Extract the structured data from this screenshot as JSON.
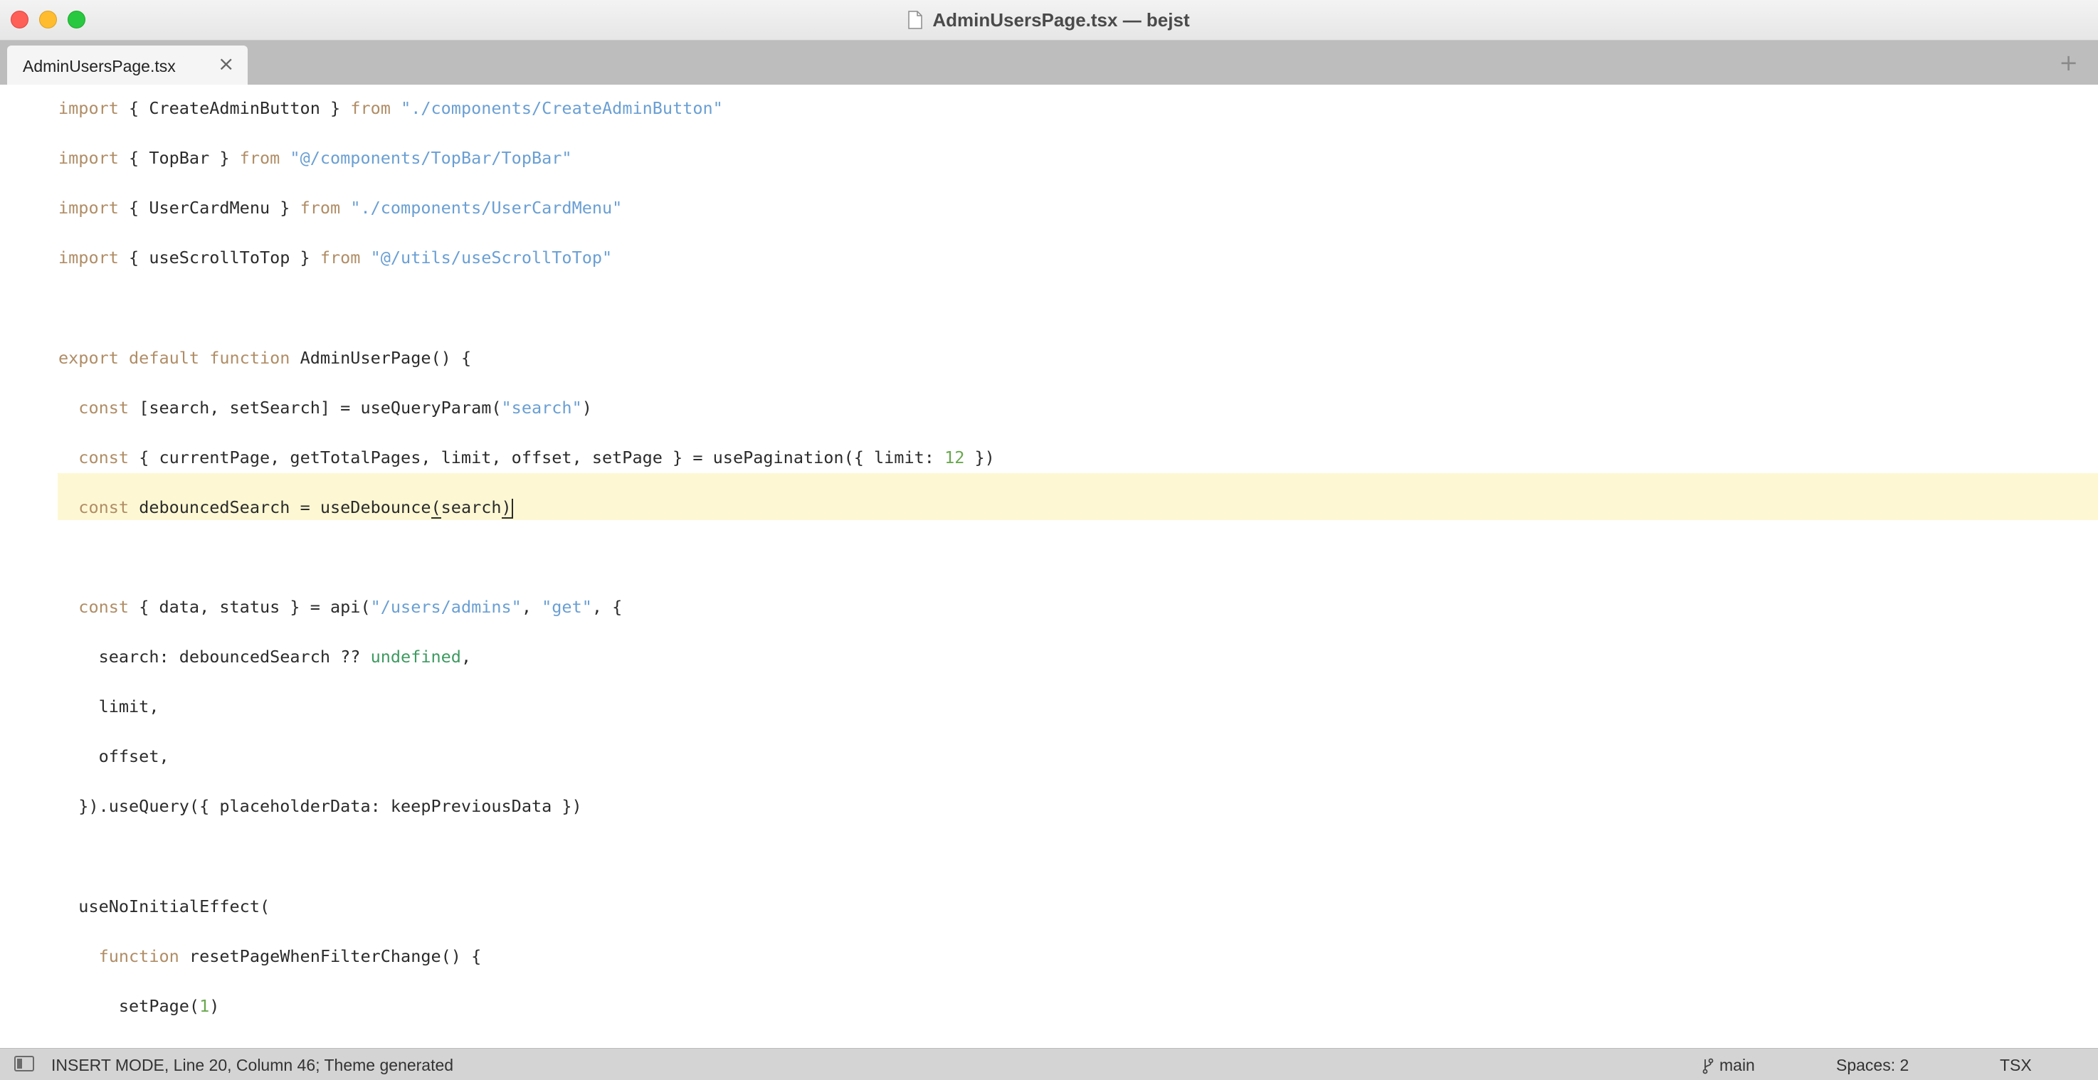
{
  "window": {
    "title": "AdminUsersPage.tsx — bejst"
  },
  "tabs": [
    {
      "label": "AdminUsersPage.tsx",
      "close_glyph": "×",
      "active": true
    }
  ],
  "tabbar": {
    "new_tab_glyph": "+"
  },
  "editor": {
    "highlighted_line": 9,
    "lines": [
      [
        {
          "t": "import",
          "c": "kw"
        },
        {
          "t": " { CreateAdminButton } ",
          "c": ""
        },
        {
          "t": "from",
          "c": "kw"
        },
        {
          "t": " ",
          "c": ""
        },
        {
          "t": "\"./components/CreateAdminButton\"",
          "c": "str"
        }
      ],
      [
        {
          "t": "import",
          "c": "kw"
        },
        {
          "t": " { TopBar } ",
          "c": ""
        },
        {
          "t": "from",
          "c": "kw"
        },
        {
          "t": " ",
          "c": ""
        },
        {
          "t": "\"@/components/TopBar/TopBar\"",
          "c": "str"
        }
      ],
      [
        {
          "t": "import",
          "c": "kw"
        },
        {
          "t": " { UserCardMenu } ",
          "c": ""
        },
        {
          "t": "from",
          "c": "kw"
        },
        {
          "t": " ",
          "c": ""
        },
        {
          "t": "\"./components/UserCardMenu\"",
          "c": "str"
        }
      ],
      [
        {
          "t": "import",
          "c": "kw"
        },
        {
          "t": " { useScrollToTop } ",
          "c": ""
        },
        {
          "t": "from",
          "c": "kw"
        },
        {
          "t": " ",
          "c": ""
        },
        {
          "t": "\"@/utils/useScrollToTop\"",
          "c": "str"
        }
      ],
      [],
      [
        {
          "t": "export default function",
          "c": "kw"
        },
        {
          "t": " AdminUserPage() {",
          "c": ""
        }
      ],
      [
        {
          "t": "  ",
          "c": ""
        },
        {
          "t": "const",
          "c": "kw"
        },
        {
          "t": " [search, setSearch] = useQueryParam(",
          "c": ""
        },
        {
          "t": "\"search\"",
          "c": "str"
        },
        {
          "t": ")",
          "c": ""
        }
      ],
      [
        {
          "t": "  ",
          "c": ""
        },
        {
          "t": "const",
          "c": "kw"
        },
        {
          "t": " { currentPage, getTotalPages, limit, offset, setPage } = usePagination({ limit: ",
          "c": ""
        },
        {
          "t": "12",
          "c": "num"
        },
        {
          "t": " })",
          "c": ""
        }
      ],
      [
        {
          "t": "  ",
          "c": ""
        },
        {
          "t": "const",
          "c": "kw"
        },
        {
          "t": " debouncedSearch = useDebounce",
          "c": ""
        },
        {
          "t": "(",
          "c": "bracket-match"
        },
        {
          "t": "search",
          "c": ""
        },
        {
          "t": ")",
          "c": "bracket-match"
        },
        {
          "t": "",
          "c": "cursor"
        }
      ],
      [],
      [
        {
          "t": "  ",
          "c": ""
        },
        {
          "t": "const",
          "c": "kw"
        },
        {
          "t": " { data, status } = api(",
          "c": ""
        },
        {
          "t": "\"/users/admins\"",
          "c": "str"
        },
        {
          "t": ", ",
          "c": ""
        },
        {
          "t": "\"get\"",
          "c": "str"
        },
        {
          "t": ", {",
          "c": ""
        }
      ],
      [
        {
          "t": "    search: debouncedSearch ?? ",
          "c": ""
        },
        {
          "t": "undefined",
          "c": "undef"
        },
        {
          "t": ",",
          "c": ""
        }
      ],
      [
        {
          "t": "    limit,",
          "c": ""
        }
      ],
      [
        {
          "t": "    offset,",
          "c": ""
        }
      ],
      [
        {
          "t": "  }).useQuery({ placeholderData: keepPreviousData })",
          "c": ""
        }
      ],
      [],
      [
        {
          "t": "  useNoInitialEffect(",
          "c": ""
        }
      ],
      [
        {
          "t": "    ",
          "c": ""
        },
        {
          "t": "function",
          "c": "kw"
        },
        {
          "t": " resetPageWhenFilterChange() {",
          "c": ""
        }
      ],
      [
        {
          "t": "      setPage(",
          "c": ""
        },
        {
          "t": "1",
          "c": "num"
        },
        {
          "t": ")",
          "c": ""
        }
      ],
      [
        {
          "t": "    },",
          "c": ""
        }
      ]
    ]
  },
  "statusbar": {
    "status_text": "INSERT MODE, Line 20, Column 46; Theme generated",
    "branch": "main",
    "spaces": "Spaces: 2",
    "syntax": "TSX"
  },
  "icons": {
    "title_document": "document-icon",
    "sidebar_toggle": "sidebar-toggle-icon",
    "branch": "git-branch-icon"
  },
  "colors": {
    "keyword": "#b08d66",
    "string": "#6a9fd3",
    "number": "#6aa84f",
    "constant": "#3e9a61",
    "current_line": "#fdf8d3",
    "tabbar_bg": "#bdbdbd",
    "statusbar_bg": "#d4d4d4"
  }
}
